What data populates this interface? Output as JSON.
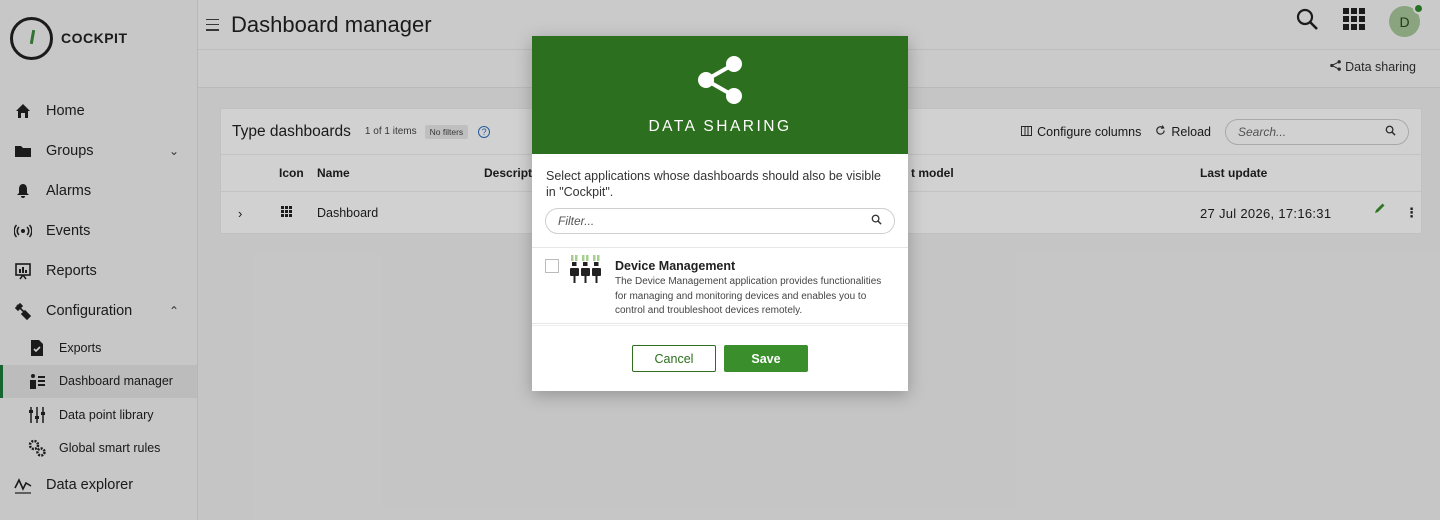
{
  "brand": {
    "name": "COCKPIT"
  },
  "sidebar": {
    "items": [
      {
        "label": "Home",
        "icon": "home-icon"
      },
      {
        "label": "Groups",
        "icon": "folder-icon"
      },
      {
        "label": "Alarms",
        "icon": "bell-icon"
      },
      {
        "label": "Events",
        "icon": "broadcast-icon"
      },
      {
        "label": "Reports",
        "icon": "report-icon"
      },
      {
        "label": "Configuration",
        "icon": "configuration-icon"
      }
    ],
    "sub_items": [
      {
        "label": "Exports",
        "icon": "export-file-icon"
      },
      {
        "label": "Dashboard manager",
        "icon": "dashboard-manager-icon"
      },
      {
        "label": "Data point library",
        "icon": "sliders-icon"
      },
      {
        "label": "Global smart rules",
        "icon": "gears-icon"
      }
    ],
    "data_explorer": {
      "label": "Data explorer",
      "icon": "chart-line-icon"
    }
  },
  "header": {
    "title": "Dashboard manager",
    "avatar_initial": "D",
    "data_sharing_label": "Data sharing"
  },
  "content": {
    "title": "Type dashboards",
    "count": "1 of 1 items",
    "filter_badge": "No filters",
    "configure_columns": "Configure columns",
    "reload": "Reload",
    "search_placeholder": "Search...",
    "columns": {
      "icon": "Icon",
      "name": "Name",
      "description": "Descript",
      "model": "t model",
      "last_update": "Last update"
    },
    "row": {
      "name": "Dashboard",
      "last_update": "27 Jul 2026, 17:16:31"
    }
  },
  "modal": {
    "title": "DATA SHARING",
    "description": "Select applications whose dashboards should also be visible in \"Cockpit\".",
    "filter_placeholder": "Filter...",
    "app": {
      "name": "Device Management",
      "description": "The Device Management application provides functionalities for managing and monitoring devices and enables you to control and troubleshoot devices remotely."
    },
    "cancel_label": "Cancel",
    "save_label": "Save"
  },
  "colors": {
    "brand_green": "#2c6f1e",
    "save_green": "#3a8f2c",
    "active_border": "#1b7a3a"
  }
}
